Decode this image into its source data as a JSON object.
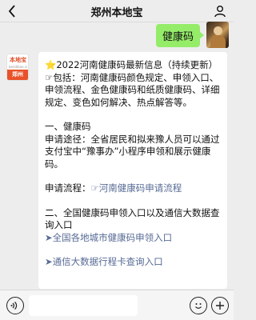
{
  "header": {
    "title": "郑州本地宝"
  },
  "outgoing": {
    "text": "健康码"
  },
  "bot": {
    "logo_top": "本地宝",
    "logo_mid": "bendibao.com",
    "logo_bottom": "郑州"
  },
  "message": {
    "title_star": "⭐",
    "title": "2022河南健康码最新信息（持续更新）",
    "intro_icon": "☞",
    "intro": "包括：河南健康码颜色规定、申领入口、申领流程、金色健康码和纸质健康码、详细规定、变色如何解决、热点解答等。",
    "section1_title": "一、健康码",
    "section1_body": "申请途径：全省居民和拟来豫人员可以通过支付宝中“豫事办”小程序申领和展示健康码。",
    "flow_label": "申请流程：",
    "flow_link": "☞河南健康码申请流程",
    "section2_title": "二、全国健康码申领入口以及通信大数据查询入口",
    "link1_arrow": "➤",
    "link1": "全国各地城市健康码申领入口",
    "link2_arrow": "➤",
    "link2": "通信大数据行程卡查询入口"
  },
  "icons": {
    "back": "chevron-left-icon",
    "profile": "person-icon",
    "voice": "voice-icon",
    "emoji": "emoji-icon",
    "plus": "plus-icon"
  }
}
